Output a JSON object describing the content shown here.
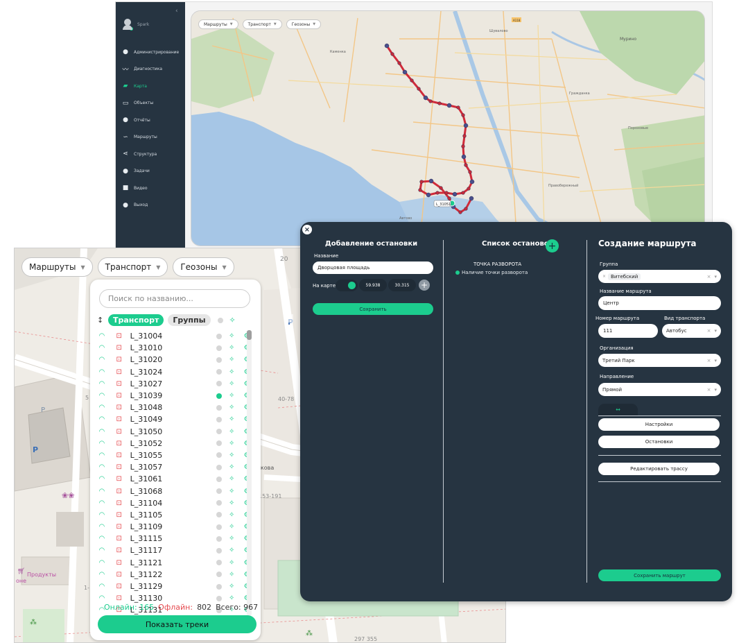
{
  "back_window": {
    "user_name": "Spark",
    "collapse_glyph": "‹",
    "nav": [
      {
        "label": "Администрирование",
        "icon": "user-icon",
        "glyph": "●"
      },
      {
        "label": "Диагностика",
        "icon": "pulse-icon",
        "glyph": "〰"
      },
      {
        "label": "Карта",
        "icon": "map-icon",
        "glyph": "▰",
        "active": true
      },
      {
        "label": "Объекты",
        "icon": "object-icon",
        "glyph": "▭"
      },
      {
        "label": "Отчёты",
        "icon": "report-icon",
        "glyph": "●"
      },
      {
        "label": "Маршруты",
        "icon": "route-icon",
        "glyph": "∽"
      },
      {
        "label": "Структура",
        "icon": "structure-icon",
        "glyph": "⋖"
      },
      {
        "label": "Задачи",
        "icon": "task-icon",
        "glyph": "●"
      },
      {
        "label": "Видео",
        "icon": "video-icon",
        "glyph": "■"
      },
      {
        "label": "Выход",
        "icon": "logout-icon",
        "glyph": "●"
      }
    ],
    "map_filters": [
      "Маршруты",
      "Транспорт",
      "Геозоны"
    ],
    "map_labels": {
      "vehicle_label": "L_31051",
      "road_a118": "A118",
      "district_murino": "Мурино",
      "district_shuvalovo": "Шувалово",
      "district_kamenka": "Каменка",
      "district_grazhdanka": "Гражданка",
      "district_okhta": "Правобережный",
      "district_kupchino": "Пороховые",
      "district_avtovo": "Автово"
    }
  },
  "accent_color": "#1ccc8e",
  "left_panel": {
    "filters": [
      "Маршруты",
      "Транспорт",
      "Геозоны"
    ],
    "search_placeholder": "Поиск по названию...",
    "tab_transport": "Транспорт",
    "tab_groups": "Группы",
    "vehicles": [
      {
        "name": "L_31004",
        "active": false
      },
      {
        "name": "L_31010",
        "active": false
      },
      {
        "name": "L_31020",
        "active": false
      },
      {
        "name": "L_31024",
        "active": false
      },
      {
        "name": "L_31027",
        "active": false
      },
      {
        "name": "L_31039",
        "active": true
      },
      {
        "name": "L_31048",
        "active": false
      },
      {
        "name": "L_31049",
        "active": false
      },
      {
        "name": "L_31050",
        "active": false
      },
      {
        "name": "L_31052",
        "active": false
      },
      {
        "name": "L_31055",
        "active": false
      },
      {
        "name": "L_31057",
        "active": false
      },
      {
        "name": "L_31061",
        "active": false
      },
      {
        "name": "L_31068",
        "active": false
      },
      {
        "name": "L_31104",
        "active": false
      },
      {
        "name": "L_31105",
        "active": false
      },
      {
        "name": "L_31109",
        "active": false
      },
      {
        "name": "L_31115",
        "active": false
      },
      {
        "name": "L_31117",
        "active": false
      },
      {
        "name": "L_31121",
        "active": false
      },
      {
        "name": "L_31122",
        "active": false
      },
      {
        "name": "L_31129",
        "active": false
      },
      {
        "name": "L_31130",
        "active": false
      },
      {
        "name": "L_31131",
        "active": false
      }
    ],
    "stats": {
      "online_label": "Онлайн:",
      "online": "165",
      "offline_label": "Офлайн:",
      "offline": "802",
      "total_label": "Всего:",
      "total": "967"
    },
    "show_tracks_label": "Показать треки",
    "map_labels": {
      "street": "акова",
      "house_1": "40-78",
      "house_2": "153-191",
      "house_3": "297 355",
      "shop": "Продукты",
      "parking": "P",
      "num_20": "20",
      "num_5": "5",
      "num_1": "1-",
      "one_1": "оне"
    }
  },
  "route_window": {
    "close_glyph": "×",
    "add_stop": {
      "title": "Добавление остановки",
      "name_label": "Название",
      "name_value": "Дворцовая площадь",
      "on_map_label": "На карте",
      "lat": "59.938",
      "lon": "30.315",
      "save_label": "Сохранить"
    },
    "stop_list": {
      "title": "Список остановок",
      "turn_title": "ТОЧКА РАЗВОРОТА",
      "turn_sub": "Наличие точки разворота"
    },
    "create_route": {
      "title": "Создание маршрута",
      "group_label": "Группа",
      "group_value": "Витебский",
      "route_name_label": "Название маршрута",
      "route_name_value": "Центр",
      "route_number_label": "Номер маршрута",
      "route_number_value": "111",
      "transport_type_label": "Вид транспорта",
      "transport_type_value": "Автобус",
      "org_label": "Организация",
      "org_value": "Третий Парк",
      "direction_label": "Направление",
      "direction_value": "Прямой",
      "tab_glyph": "↔",
      "settings_label": "Настройки",
      "stops_label": "Остановки",
      "edit_track_label": "Редактировать трассу",
      "save_route_label": "Сохранить маршрут"
    }
  }
}
